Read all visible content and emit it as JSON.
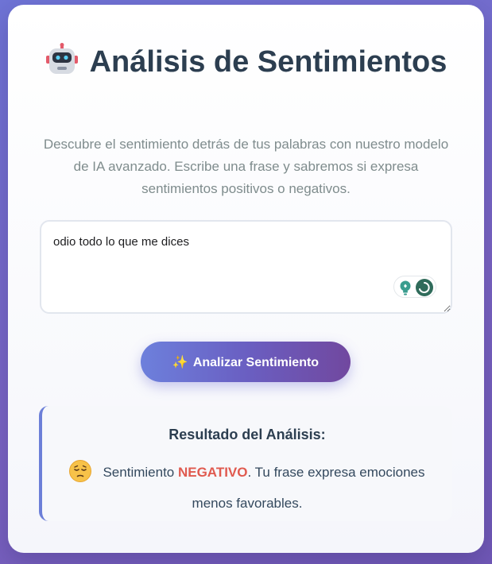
{
  "header": {
    "title": "Análisis de Sentimientos",
    "icon": "robot-icon",
    "subtitle": "Descubre el sentimiento detrás de tus palabras con nuestro modelo de IA avanzado. Escribe una frase y sabremos si expresa sentimientos positivos o negativos."
  },
  "input": {
    "value": "odio todo lo que me dices",
    "widget_icons": [
      "lightbulb-icon",
      "swirl-icon"
    ]
  },
  "button": {
    "icon": "sparkles-icon",
    "label": "Analizar Sentimiento"
  },
  "result": {
    "title": "Resultado del Análisis:",
    "icon": "pensive-face-icon",
    "prefix": "Sentimiento ",
    "sentiment": "NEGATIVO",
    "suffix": ". Tu frase expresa emociones menos favorables."
  },
  "colors": {
    "accent": "#6c7fd8",
    "negative": "#e05a4f",
    "title": "#2c3e50"
  }
}
